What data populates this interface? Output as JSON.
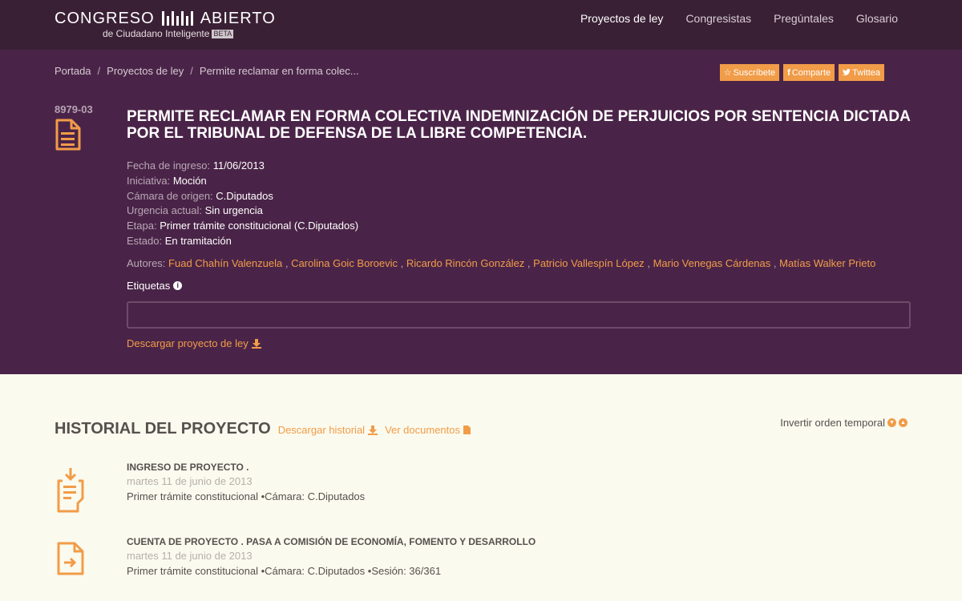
{
  "brand": {
    "name_left": "CONGRESO",
    "name_right": "ABIERTO",
    "sub": "de Ciudadano Inteligente",
    "badge": "BETA"
  },
  "nav": [
    {
      "label": "Proyectos de ley"
    },
    {
      "label": "Congresistas"
    },
    {
      "label": "Pregúntales"
    },
    {
      "label": "Glosario"
    }
  ],
  "breadcrumb": {
    "home": "Portada",
    "section": "Proyectos de ley",
    "current": "Permite reclamar en forma colec...",
    "separator": "/"
  },
  "social": {
    "subscribe": "Suscríbete",
    "share": "Comparte",
    "tweet": "Twittea"
  },
  "bill": {
    "id": "8979-03",
    "title": "PERMITE RECLAMAR EN FORMA COLECTIVA INDEMNIZACIÓN DE PERJUICIOS POR SENTENCIA DICTADA POR EL TRIBUNAL DE DEFENSA DE LA LIBRE COMPETENCIA.",
    "meta": [
      {
        "key": "Fecha de ingreso:",
        "value": "11/06/2013"
      },
      {
        "key": "Iniciativa:",
        "value": "Moción"
      },
      {
        "key": "Cámara de origen:",
        "value": "C.Diputados"
      },
      {
        "key": "Urgencia actual:",
        "value": "Sin urgencia"
      },
      {
        "key": "Etapa:",
        "value": "Primer trámite constitucional (C.Diputados)"
      },
      {
        "key": "Estado:",
        "value": "En tramitación"
      }
    ],
    "authors_label": "Autores:",
    "authors": [
      "Fuad Chahín Valenzuela",
      "Carolina Goic Boroevic",
      "Ricardo Rincón González",
      "Patricio Vallespín López",
      "Mario Venegas Cárdenas",
      "Matías Walker Prieto"
    ],
    "author_sep": ",",
    "tags_label": "Etiquetas",
    "tags_value": "",
    "download_label": "Descargar proyecto de ley"
  },
  "history": {
    "title": "HISTORIAL DEL PROYECTO",
    "download_label": "Descargar historial",
    "docs_label": "Ver documentos",
    "invert_label": "Invertir orden temporal",
    "events": [
      {
        "title": "INGRESO DE PROYECTO .",
        "date": "martes 11 de junio de 2013",
        "desc": "Primer trámite constitucional •Cámara: C.Diputados"
      },
      {
        "title": "CUENTA DE PROYECTO . PASA A COMISIÓN DE ECONOMÍA, FOMENTO Y DESARROLLO",
        "date": "martes 11 de junio de 2013",
        "desc": "Primer trámite constitucional •Cámara: C.Diputados •Sesión: 36/361"
      }
    ]
  },
  "colors": {
    "nav_bg": "#3a2035",
    "hero_bg": "#4a2448",
    "accent": "#f19c48",
    "page_bg": "#fbfaee"
  }
}
